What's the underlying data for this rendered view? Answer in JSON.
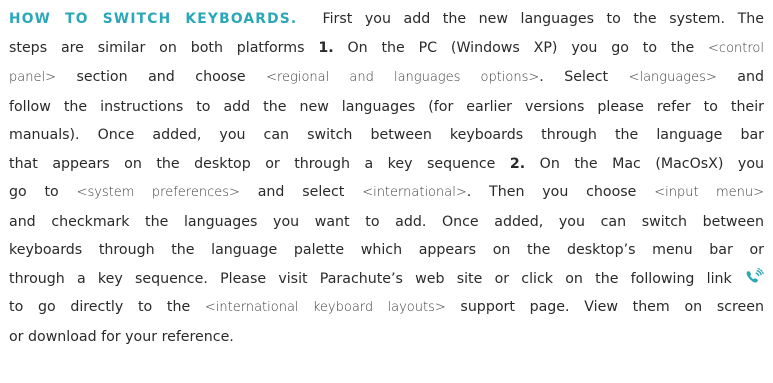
{
  "heading": "HOW TO SWITCH KEYBOARDS.",
  "lines": {
    "l1": "First you add the new languages to the system.  The",
    "l2a": "steps are similar on both platforms ",
    "step1": "1.",
    "l2b": " On the PC (Windows XP) you go to the ",
    "code1": "<control",
    "code1b": "panel>",
    "l3a": " section and choose ",
    "code2": "<regional and languages options>",
    "l3b": ".  Select ",
    "code3": "<languages>",
    "l3c": " and",
    "l4": "follow the instructions to add the new languages (for earlier versions please refer to their",
    "l5": "manuals).  Once added, you can switch between keyboards through the language bar",
    "l6a": "that appears on the desktop or through a key sequence ",
    "step2": "2.",
    "l6b": " On the Mac (MacOsX) you",
    "l7a": "go to ",
    "code4": "<system preferences>",
    "l7b": " and select ",
    "code5": "<international>",
    "l7c": ".  Then you choose ",
    "code6": "<input menu>",
    "l8": "and checkmark the languages you want to add.  Once added, you can switch between",
    "l9": "keyboards through the language palette which appears on the desktop’s menu bar or",
    "l10": "through a key sequence.  Please visit Parachute’s web site or click on the following link ",
    "l11a": "to go directly to the ",
    "code7": "<international keyboard layouts>",
    "l11b": " support page.  View them on screen",
    "l12": "or download for your reference."
  },
  "icons": {
    "link_icon": "phone-link-icon"
  },
  "colors": {
    "heading": "#2aa7b8",
    "icon": "#2aa7b8",
    "text": "#2a2a2a"
  }
}
